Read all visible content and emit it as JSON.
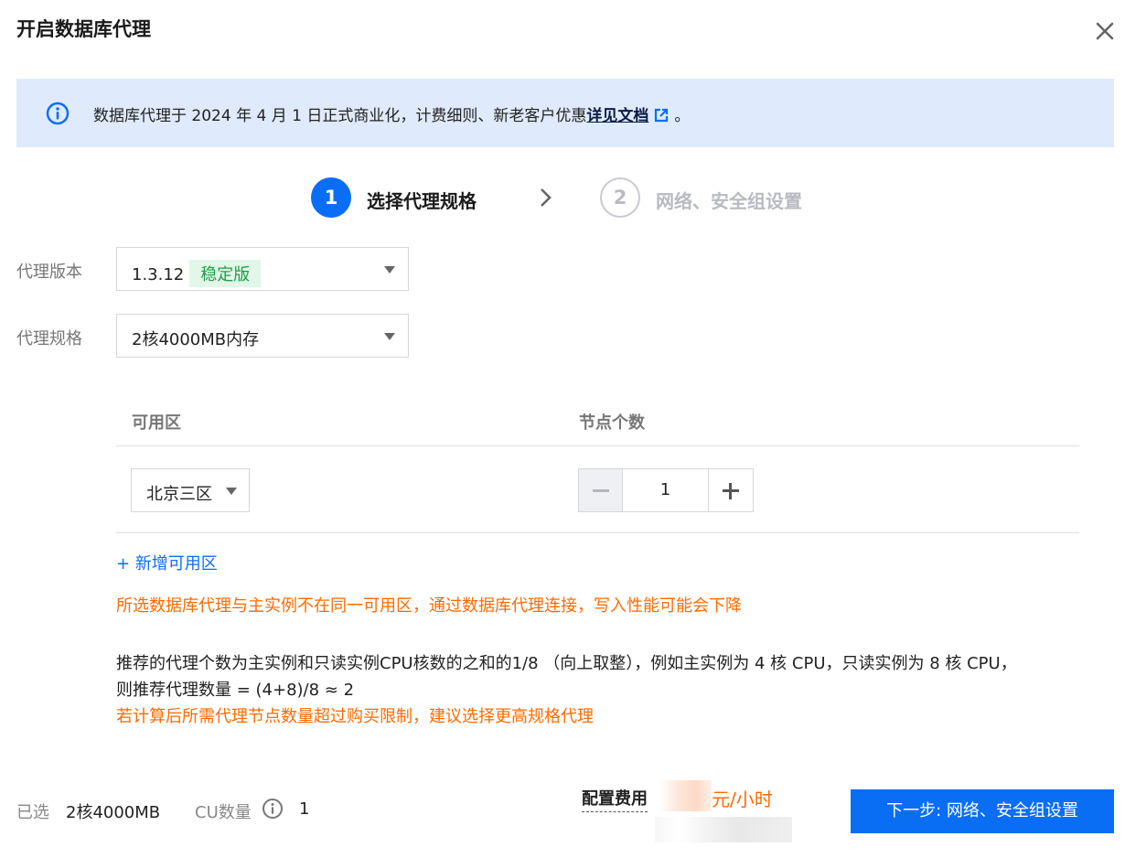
{
  "dialog": {
    "title": "开启数据库代理"
  },
  "notice": {
    "text": "数据库代理于 2024 年 4 月 1 日正式商业化，计费细则、新老客户优惠",
    "link": "详见文档",
    "suffix": "。"
  },
  "steps": [
    {
      "number": "1",
      "label": "选择代理规格",
      "state": "active"
    },
    {
      "number": "2",
      "label": "网络、安全组设置",
      "state": "inactive"
    }
  ],
  "form": {
    "version": {
      "label": "代理版本",
      "value": "1.3.12",
      "tag": "稳定版"
    },
    "spec": {
      "label": "代理规格",
      "value": "2核4000MB内存"
    }
  },
  "az_table": {
    "headers": [
      "可用区",
      "节点个数"
    ],
    "rows": [
      {
        "zone": "北京三区",
        "count": "1"
      }
    ],
    "add_label": "+ 新增可用区"
  },
  "messages": {
    "az_warning": "所选数据库代理与主实例不在同一可用区，通过数据库代理连接，写入性能可能会下降",
    "tip_line1": "推荐的代理个数为主实例和只读实例CPU核数的之和的1/8 （向上取整），例如主实例为 4 核 CPU，只读实例为 8 核 CPU，",
    "tip_line2": "则推荐代理数量 = (4+8)/8 ≈ 2",
    "limit_warning": "若计算后所需代理节点数量超过购买限制，建议选择更高规格代理"
  },
  "footer": {
    "selected_label": "已选",
    "selected_value": "2核4000MB",
    "cu_label": "CU数量",
    "cu_value": "1",
    "fee_label": "配置费用",
    "fee_unit": "元/小时",
    "next_button": "下一步: 网络、安全组设置"
  },
  "colors": {
    "primary": "#0a6ef5",
    "warning": "#ff6a00",
    "notice_bg": "#dfeafc",
    "stable_tag_bg": "#e3f7e9",
    "stable_tag_text": "#1aa146"
  },
  "icons": {
    "close": "close-icon",
    "info": "info-icon",
    "external_link": "external-link-icon",
    "step_arrow": "chevron-right-icon",
    "caret": "caret-down-icon",
    "cu_help": "info-circle-icon"
  }
}
